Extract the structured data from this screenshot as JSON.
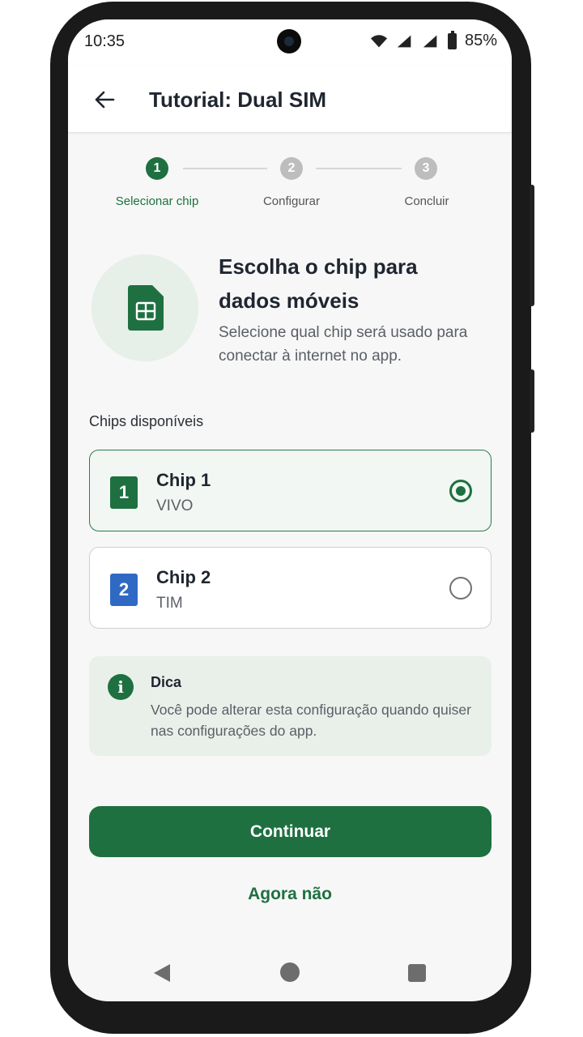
{
  "status": {
    "time": "10:35",
    "battery": "85%"
  },
  "appbar": {
    "title": "Tutorial: Dual SIM"
  },
  "stepper": {
    "current": 1,
    "steps": [
      {
        "number": "1",
        "label": "Selecionar chip"
      },
      {
        "number": "2",
        "label": "Configurar"
      },
      {
        "number": "3",
        "label": "Concluir"
      }
    ]
  },
  "hero": {
    "title": "Escolha o chip para dados móveis",
    "description": "Selecione qual chip será usado para conectar à internet no app."
  },
  "chips": {
    "section_label": "Chips disponíveis",
    "items": [
      {
        "badge": "1",
        "name": "Chip 1",
        "carrier": "VIVO",
        "selected": true,
        "color": "#1e7040"
      },
      {
        "badge": "2",
        "name": "Chip 2",
        "carrier": "TIM",
        "selected": false,
        "color": "#2f69c4"
      }
    ]
  },
  "tip": {
    "icon": "info-icon",
    "title": "Dica",
    "text": "Você pode alterar esta configuração quando quiser nas configurações do app."
  },
  "actions": {
    "primary": "Continuar",
    "secondary": "Agora não"
  },
  "colors": {
    "accent": "#1e7040",
    "chip2": "#2f69c4",
    "inactive_step": "#bdbdbd"
  }
}
